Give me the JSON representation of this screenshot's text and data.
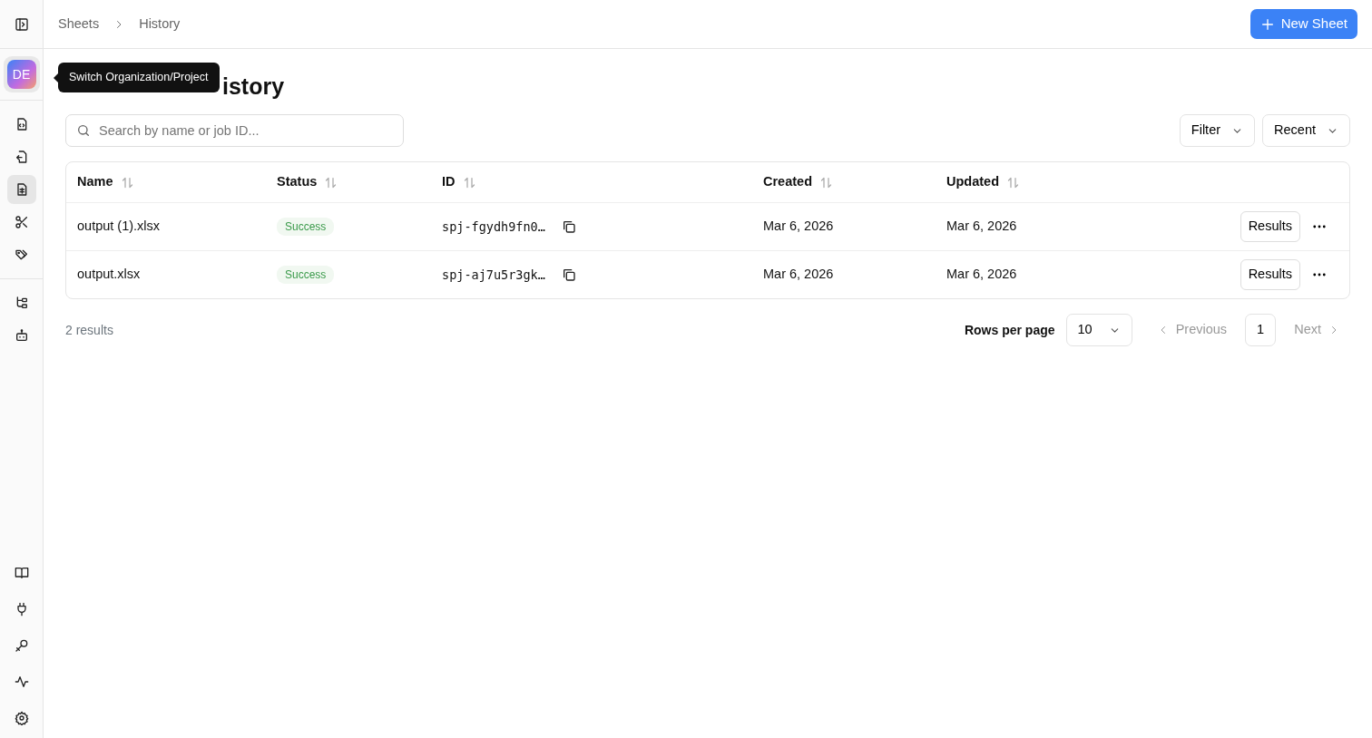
{
  "sidebar": {
    "org_avatar": "DE",
    "tooltip": "Switch Organization/Project",
    "items": [
      {
        "selected": false
      },
      {
        "selected": false
      },
      {
        "selected": true
      },
      {
        "selected": false
      },
      {
        "selected": false
      },
      {
        "selected": false
      },
      {
        "selected": false
      }
    ]
  },
  "breadcrumb": [
    "Sheets",
    "History"
  ],
  "new_button": "New Sheet",
  "title": "istory",
  "search": {
    "placeholder": "Search by name or job ID..."
  },
  "filters": [
    "Filter",
    "Recent"
  ],
  "table": {
    "columns": [
      "Name",
      "Status",
      "ID",
      "Created",
      "Updated"
    ],
    "rows": [
      {
        "name": "output (1).xlsx",
        "status": "Success",
        "id": "spj-fgydh9fn0…",
        "created": "Mar 6, 2026",
        "updated": "Mar 6, 2026",
        "action": "Results"
      },
      {
        "name": "output.xlsx",
        "status": "Success",
        "id": "spj-aj7u5r3gk…",
        "created": "Mar 6, 2026",
        "updated": "Mar 6, 2026",
        "action": "Results"
      }
    ]
  },
  "footer": {
    "count": "2 results",
    "rows_label": "Rows per page",
    "rows_value": "10",
    "previous": "Previous",
    "page": "1",
    "next": "Next"
  }
}
